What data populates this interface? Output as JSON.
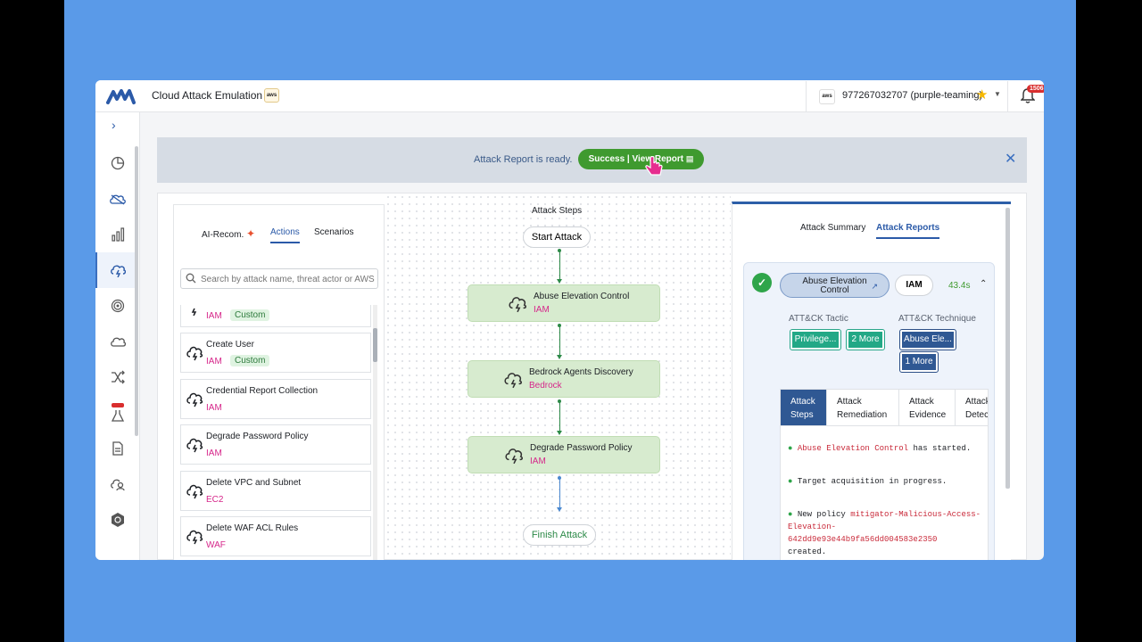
{
  "app": {
    "title": "Cloud Attack Emulation",
    "aws_badge": "aws"
  },
  "account": {
    "aws_badge": "aws",
    "name": "977267032707 (purple-teaming)",
    "notifications": "1506"
  },
  "banner": {
    "message": "Attack Report is ready.",
    "button": "Success | View Report"
  },
  "left_tabs": {
    "ai": "AI-Recom.",
    "actions": "Actions",
    "scenarios": "Scenarios"
  },
  "search": {
    "placeholder": "Search by attack name, threat actor or AWS"
  },
  "actions": [
    {
      "name": "",
      "service": "IAM",
      "tag": "Custom"
    },
    {
      "name": "Create User",
      "service": "IAM",
      "tag": "Custom"
    },
    {
      "name": "Credential Report Collection",
      "service": "IAM",
      "tag": ""
    },
    {
      "name": "Degrade Password Policy",
      "service": "IAM",
      "tag": ""
    },
    {
      "name": "Delete VPC and Subnet",
      "service": "EC2",
      "tag": ""
    },
    {
      "name": "Delete WAF ACL Rules",
      "service": "WAF",
      "tag": ""
    }
  ],
  "flow": {
    "title": "Attack Steps",
    "start": "Start Attack",
    "finish": "Finish Attack",
    "steps": [
      {
        "name": "Abuse Elevation Control",
        "service": "IAM"
      },
      {
        "name": "Bedrock Agents Discovery",
        "service": "Bedrock"
      },
      {
        "name": "Degrade Password Policy",
        "service": "IAM"
      }
    ]
  },
  "right": {
    "tabs": {
      "summary": "Attack Summary",
      "reports": "Attack Reports"
    },
    "technique_line1": "Abuse Elevation",
    "technique_line2": "Control",
    "service": "IAM",
    "duration": "43.4s",
    "tactic_label": "ATT&CK Tactic",
    "technique_label": "ATT&CK Technique",
    "tactic": "Privilege...",
    "tactic_more": "2 More",
    "technique": "Abuse Ele...",
    "technique_more": "1 More",
    "step_tabs": {
      "steps_1": "Attack",
      "steps_2": "Steps",
      "remediation_1": "Attack",
      "remediation_2": "Remediation",
      "evidence_1": "Attack",
      "evidence_2": "Evidence",
      "detection_1": "Attack",
      "detection_2": "Detec"
    },
    "log": {
      "l1_name": "Abuse Elevation Control",
      "l1_rest": " has started.",
      "l2": "Target acquisition in progress.",
      "l3_pre": "New policy ",
      "l3_policy_a": "mitigator-Malicious-Access-",
      "l3_policy_b": "Elevation-",
      "l3_policy_c": "642dd9e93e44b9fa56dd004583e2350",
      "l3_post": "created."
    }
  },
  "colors": {
    "accent": "#2b5aa8",
    "success": "#3f9a2f",
    "service": "#d6268a",
    "node": "#d7ebcf",
    "background": "#5a9ae8"
  }
}
